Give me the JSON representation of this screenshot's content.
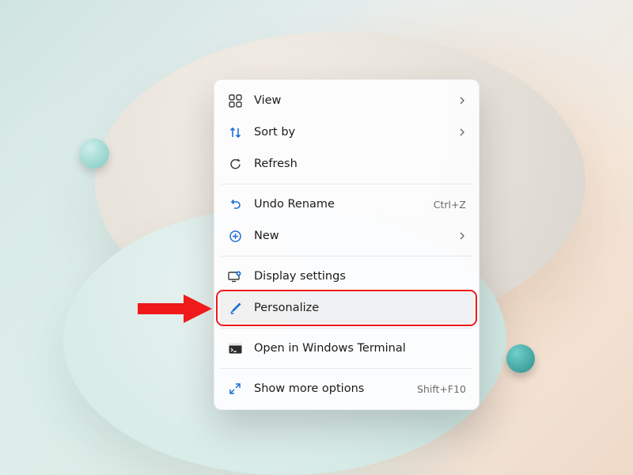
{
  "menu": {
    "groups": [
      [
        {
          "id": "view",
          "label": "View",
          "icon": "grid",
          "submenu": true
        },
        {
          "id": "sort",
          "label": "Sort by",
          "icon": "sort",
          "submenu": true
        },
        {
          "id": "refresh",
          "label": "Refresh",
          "icon": "refresh"
        }
      ],
      [
        {
          "id": "undo",
          "label": "Undo Rename",
          "icon": "undo",
          "accel": "Ctrl+Z"
        },
        {
          "id": "new",
          "label": "New",
          "icon": "plus",
          "submenu": true
        }
      ],
      [
        {
          "id": "display",
          "label": "Display settings",
          "icon": "display"
        },
        {
          "id": "personalize",
          "label": "Personalize",
          "icon": "brush",
          "highlighted": true
        }
      ],
      [
        {
          "id": "terminal",
          "label": "Open in Windows Terminal",
          "icon": "terminal"
        }
      ],
      [
        {
          "id": "more",
          "label": "Show more options",
          "icon": "expand",
          "accel": "Shift+F10"
        }
      ]
    ]
  },
  "annotation": {
    "arrow_target": "personalize",
    "arrow_color": "#ef1a1a"
  }
}
